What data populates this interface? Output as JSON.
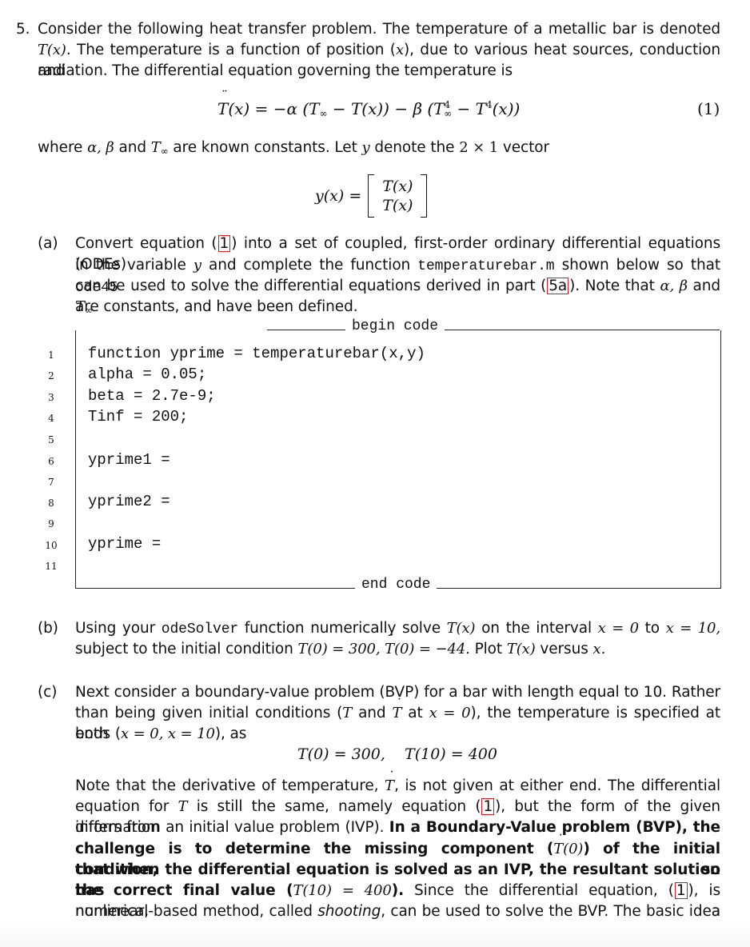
{
  "problem": {
    "number": "5.",
    "intro_lines": [
      [
        "Consider the following heat transfer problem.  The temperature of a metallic bar is denoted"
      ],
      [
        "T(x)",
        ". The temperature is a function of position (",
        "x",
        "), due to various heat sources, conduction and"
      ],
      [
        "radiation. The differential equation governing the temperature is"
      ]
    ],
    "equation1": {
      "lhs": "T",
      "lhs_arg": "(x) = −α (T",
      "inf": "∞",
      "mid": " − T(x)) − β (T",
      "sup4": "4",
      "inf2": "∞",
      "tail": " − T",
      "sup4b": "4",
      "end": "(x))",
      "number": "(1)"
    },
    "where_line": [
      "where ",
      "α, β",
      " and ",
      "T",
      "∞",
      " are known constants. Let ",
      "y",
      " denote the ",
      "2 × 1",
      " vector"
    ],
    "vector": {
      "lhs": "y(x) =",
      "row1": "T(x)",
      "row2": "T(x)"
    }
  },
  "part_a": {
    "label": "(a)",
    "l1_pre": "Convert equation (",
    "l1_ref": "1",
    "l1_post": ") into a set of coupled, first-order ordinary differential equations (ODEs)",
    "l2_pre": "in the variable ",
    "l2_var": "y",
    "l2_mid": " and complete the function ",
    "l2_file": "temperaturebar.m",
    "l2_mid2": " shown below so that ",
    "l2_solver": "ode45",
    "l3_pre": "can be used to solve the differential equations derived in part (",
    "l3_ref": "5a",
    "l3_post": "). Note that ",
    "l3_math": "α, β",
    "l3_and": " and ",
    "l3_T": "T",
    "l3_inf": "∞",
    "l4": "are constants, and have been defined.",
    "code": {
      "begin_label": "begin code",
      "end_label": "end code",
      "lines": [
        {
          "n": "1",
          "text": "function yprime = temperaturebar(x,y)"
        },
        {
          "n": "2",
          "text": "alpha = 0.05;"
        },
        {
          "n": "3",
          "text": "beta = 2.7e-9;"
        },
        {
          "n": "4",
          "text": "Tinf = 200;"
        },
        {
          "n": "5",
          "text": ""
        },
        {
          "n": "6",
          "text": "yprime1 ="
        },
        {
          "n": "7",
          "text": ""
        },
        {
          "n": "8",
          "text": "yprime2 ="
        },
        {
          "n": "9",
          "text": ""
        },
        {
          "n": "10",
          "text": "yprime ="
        },
        {
          "n": "11",
          "text": ""
        }
      ]
    }
  },
  "part_b": {
    "label": "(b)",
    "l1_pre": "Using your ",
    "l1_func": "odeSolver",
    "l1_mid": " function numerically solve ",
    "l1_T": "T(x)",
    "l1_mid2": " on the interval ",
    "l1_interval": "x = 0",
    "l1_to": " to ",
    "l1_interval2": "x = 10,",
    "l2_pre": "subject to the initial condition ",
    "l2_ic": "T(0) = 300, ",
    "l2_ic2": "T(0) = −44.",
    "l2_mid": " Plot ",
    "l2_T": "T(x)",
    "l2_versus": " versus ",
    "l2_x": "x."
  },
  "part_c": {
    "label": "(c)",
    "l1": "Next consider a boundary-value problem (BVP) for a bar with length equal to 10.  Rather",
    "l2_pre": "than being given initial conditions (",
    "l2_T": "T",
    "l2_and": " and ",
    "l2_Tdot": "T",
    "l2_at": " at ",
    "l2_x": "x = 0",
    "l2_post": "), the temperature is specified at both",
    "l3_pre": "ends (",
    "l3_x": "x = 0, x = 10",
    "l3_post": "), as",
    "bc": "T(0) = 300,    T(10) = 400",
    "p1_pre": "Note that the derivative of temperature, ",
    "p1_T": "T",
    "p1_post": ", is not given at either end.  The differential",
    "p2_pre": "equation for ",
    "p2_T": "T",
    "p2_mid": " is still the same, namely equation (",
    "p2_ref": "1",
    "p2_post": "), but the form of the given information",
    "p3_pre": "differs from an initial value problem (IVP). ",
    "p3_bold": "In a Boundary-Value problem (BVP), the",
    "p4_bold_pre": "challenge is to determine the missing component (",
    "p4_T": "T(0)",
    "p4_bold_post": ") of the initial condition, so",
    "p5_bold": "that when the differential equation is solved as an IVP, the resultant solution has",
    "p6_bold_pre": "the correct final value (",
    "p6_math": "T(10) = 400",
    "p6_bold_post": ").",
    "p6_rest": " Since the differential equation, (",
    "p6_ref": "1",
    "p6_tail": "), is nonlinear, a",
    "p7_pre": "numerical-based method, called ",
    "p7_italic": "shooting",
    "p7_post": ", can be used to solve the BVP. The basic idea is to"
  },
  "colors": {
    "reference_box": "#e0141a",
    "text": "#111111"
  }
}
